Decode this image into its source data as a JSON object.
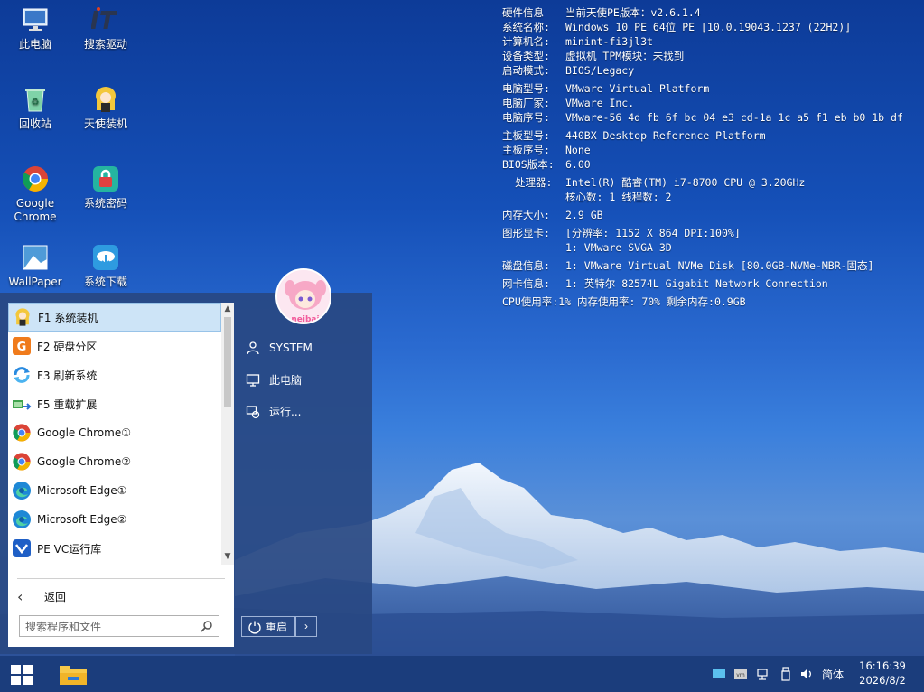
{
  "desktop": {
    "icons": [
      {
        "label": "此电脑",
        "icon": "monitor-icon"
      },
      {
        "label": "搜索驱动",
        "icon": "it-icon"
      },
      {
        "label": "回收站",
        "icon": "recycle-bin-icon"
      },
      {
        "label": "天使装机",
        "icon": "angel-icon"
      },
      {
        "label": "Google\nChrome",
        "icon": "chrome-icon"
      },
      {
        "label": "系统密码",
        "icon": "password-icon"
      },
      {
        "label": "WallPaper",
        "icon": "wallpaper-icon"
      },
      {
        "label": "系统下载",
        "icon": "cloud-download-icon"
      }
    ]
  },
  "sysinfo": {
    "rows": [
      {
        "k": "硬件信息",
        "v": "当前天使PE版本：v2.6.1.4"
      },
      {
        "k": "系统名称:",
        "v": "Windows 10 PE 64位 PE [10.0.19043.1237 (22H2)]"
      },
      {
        "k": "计算机名:",
        "v": "minint-fi3jl3t"
      },
      {
        "k": "设备类型:",
        "v": "虚拟机 TPM模块：未找到"
      },
      {
        "k": "启动模式:",
        "v": "BIOS/Legacy"
      },
      {
        "k": "电脑型号:",
        "v": "VMware Virtual Platform"
      },
      {
        "k": "电脑厂家:",
        "v": "VMware Inc."
      },
      {
        "k": "电脑序号:",
        "v": "VMware-56 4d fb 6f bc 04 e3 cd-1a 1c a5 f1 eb b0 1b df"
      },
      {
        "k": "主板型号:",
        "v": "440BX Desktop Reference Platform"
      },
      {
        "k": "主板序号:",
        "v": "None"
      },
      {
        "k": "BIOS版本:",
        "v": "6.00"
      },
      {
        "k": "处理器:",
        "v": "Intel(R) 酷睿(TM) i7-8700 CPU @ 3.20GHz"
      },
      {
        "k": "",
        "v": "核心数: 1  线程数: 2"
      },
      {
        "k": "内存大小:",
        "v": "2.9 GB"
      },
      {
        "k": "图形显卡:",
        "v": "[分辨率: 1152 X 864 DPI:100%]"
      },
      {
        "k": "",
        "v": "1: VMware SVGA 3D"
      },
      {
        "k": "磁盘信息:",
        "v": "1: VMware Virtual NVMe Disk [80.0GB-NVMe-MBR-固态]"
      },
      {
        "k": "网卡信息:",
        "v": "1: 英特尔 82574L Gigabit Network Connection"
      },
      {
        "k": "CPU使用率:",
        "v": "1% 内存使用率: 70% 剩余内存:0.9GB"
      }
    ]
  },
  "start_menu": {
    "apps": [
      {
        "label": "F1 系统装机",
        "icon": "angel-icon",
        "selected": true
      },
      {
        "label": "F2 硬盘分区",
        "icon": "disk-genius-icon"
      },
      {
        "label": "F3 刷新系统",
        "icon": "refresh-icon"
      },
      {
        "label": "F5 重载扩展",
        "icon": "reload-extension-icon"
      },
      {
        "label": "Google Chrome①",
        "icon": "chrome-icon"
      },
      {
        "label": "Google Chrome②",
        "icon": "chrome-icon"
      },
      {
        "label": "Microsoft Edge①",
        "icon": "edge-icon"
      },
      {
        "label": "Microsoft Edge②",
        "icon": "edge-icon"
      },
      {
        "label": "PE VC运行库",
        "icon": "visual-studio-icon"
      }
    ],
    "back_label": "返回",
    "search_placeholder": "搜索程序和文件",
    "avatar_text": "neibai",
    "right_items": [
      {
        "label": "SYSTEM",
        "icon": "user-icon"
      },
      {
        "label": "此电脑",
        "icon": "computer-icon"
      },
      {
        "label": "运行...",
        "icon": "run-icon"
      }
    ],
    "restart_label": "重启"
  },
  "taskbar": {
    "ime": "简体",
    "time": "16:16:39",
    "date": "2026/8/2"
  }
}
